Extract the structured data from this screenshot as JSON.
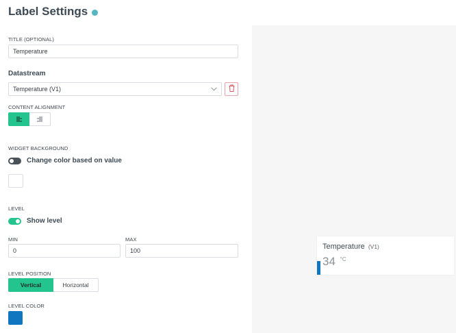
{
  "header": {
    "title": "Label Settings"
  },
  "title_field": {
    "label": "TITLE (OPTIONAL)",
    "value": "Temperature"
  },
  "datastream": {
    "label": "Datastream",
    "selected": "Temperature (V1)"
  },
  "content_alignment": {
    "label": "CONTENT ALIGNMENT",
    "selected": "left",
    "options": [
      "left",
      "right"
    ]
  },
  "widget_background": {
    "label": "WIDGET BACKGROUND",
    "toggle_label": "Change color based on value",
    "toggle_on": false,
    "color": "#ffffff"
  },
  "level": {
    "label": "LEVEL",
    "toggle_label": "Show level",
    "toggle_on": true
  },
  "min": {
    "label": "MIN",
    "value": "0"
  },
  "max": {
    "label": "MAX",
    "value": "100"
  },
  "level_position": {
    "label": "LEVEL POSITION",
    "options": [
      "Vertical",
      "Horizontal"
    ],
    "selected": "Vertical"
  },
  "level_color": {
    "label": "LEVEL COLOR",
    "color": "#1176c0"
  },
  "preview": {
    "title": "Temperature",
    "datastream": "(V1)",
    "value": "34",
    "unit": "°C"
  },
  "colors": {
    "accent": "#23c48e",
    "info": "#54b6c1",
    "danger": "#e8a3a8",
    "level": "#1176c0"
  }
}
